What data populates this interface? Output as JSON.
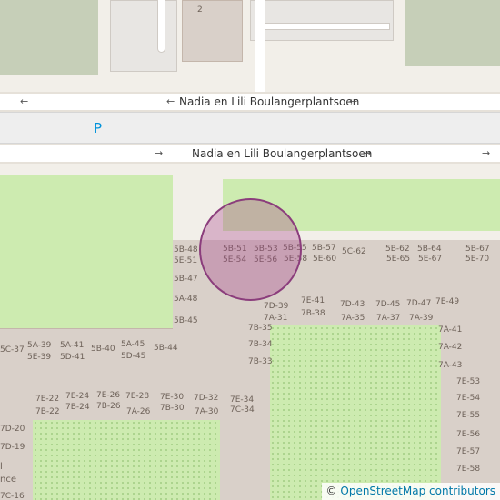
{
  "map": {
    "streets": [
      {
        "name": "Nadia en Lili Boulangerplantsoen",
        "arrow_before": "←",
        "arrow_after": "←",
        "edge_arrow": "←"
      },
      {
        "name": "Nadia en Lili Boulangerplantsoen",
        "arrow_before": "→",
        "arrow_after": "→",
        "edge_arrow": "→"
      }
    ],
    "parking_symbol": "P",
    "house_number_top": "2",
    "house_numbers": [
      "5B-48",
      "5E-51",
      "5B-51",
      "5E-54",
      "5B-53",
      "5E-56",
      "5B-55",
      "5E-58",
      "5B-57",
      "5E-60",
      "5C-62",
      "5B-62",
      "5E-65",
      "5B-64",
      "5E-67",
      "5B-67",
      "5E-70",
      "5B-47",
      "5A-48",
      "5B-45",
      "7D-39",
      "7A-31",
      "7E-41",
      "7B-38",
      "7D-43",
      "7A-35",
      "7D-45",
      "7A-37",
      "7D-47",
      "7A-39",
      "7E-49",
      "7B-35",
      "7B-34",
      "7B-33",
      "7A-41",
      "7A-42",
      "7A-43",
      "5C-37",
      "5A-39",
      "5E-39",
      "5A-41",
      "5D-41",
      "5B-40",
      "5A-45",
      "5D-45",
      "5B-44",
      "7E-22",
      "7B-22",
      "7E-24",
      "7B-24",
      "7E-26",
      "7B-26",
      "7E-28",
      "7A-26",
      "7E-30",
      "7B-30",
      "7D-32",
      "7A-30",
      "7E-34",
      "7C-34",
      "7E-53",
      "7E-54",
      "7E-55",
      "7E-56",
      "7E-57",
      "7E-58",
      "7D-20",
      "7D-19",
      "7C-16"
    ],
    "fragments": [
      "l",
      "nce"
    ],
    "colors": {
      "background": "#f2efe9",
      "building": "#d9d0c9",
      "park": "#cdebb0",
      "parking_symbol": "#0092da",
      "marker_fill": "#a8408a",
      "marker_stroke": "#8b3d7c",
      "attribution_link": "#0078a8"
    }
  },
  "attribution": {
    "symbol": "©",
    "text": "OpenStreetMap contributors"
  }
}
